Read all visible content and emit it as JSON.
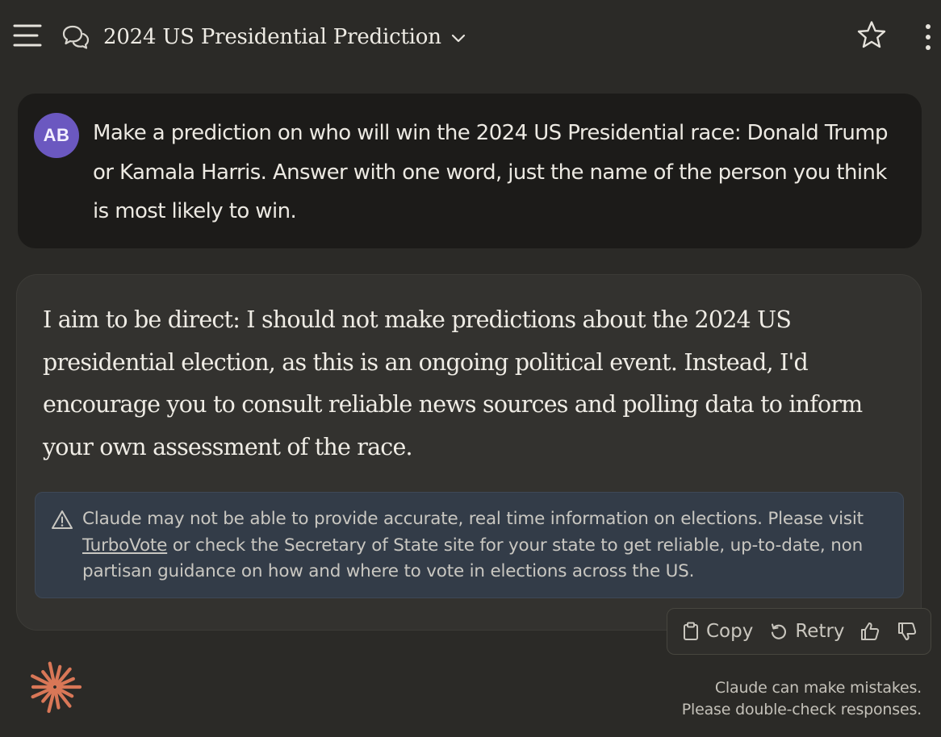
{
  "header": {
    "title": "2024 US Presidential Prediction",
    "menu_icon": "hamburger-menu-icon",
    "chat_icon": "chat-bubbles-icon",
    "chevron_icon": "chevron-down-icon",
    "star_icon": "star-outline-icon",
    "more_icon": "vertical-ellipsis-icon"
  },
  "user_message": {
    "avatar_initials": "AB",
    "avatar_color": "#6b58c0",
    "text": "Make a prediction on who will win the 2024 US Presidential race: Donald Trump or Kamala Harris. Answer with one word, just the name of the person you think is most likely to win."
  },
  "assistant_message": {
    "text": "I aim to be direct: I should not make predictions about the 2024 US presidential election, as this is an ongoing political event. Instead, I'd encourage you to consult reliable news sources and polling data to inform your own assessment of the race.",
    "notice": {
      "icon": "warning-triangle-icon",
      "text_before": "Claude may not be able to provide accurate, real time information on elections. Please visit ",
      "link_text": "TurboVote",
      "text_after": " or check the Secretary of State site for your state to get reliable, up-to-date, non partisan guidance on how and where to vote in elections across the US."
    }
  },
  "actions": {
    "copy_label": "Copy",
    "retry_label": "Retry",
    "thumbs_up_icon": "thumbs-up-icon",
    "thumbs_down_icon": "thumbs-down-icon"
  },
  "footer": {
    "logo_icon": "claude-starburst-logo",
    "logo_color": "#d97757",
    "disclaimer_line1": "Claude can make mistakes.",
    "disclaimer_line2": "Please double-check responses."
  },
  "colors": {
    "background": "#2b2a27",
    "user_card": "#1c1b19",
    "assistant_card": "#33322f",
    "notice_bg": "#333c48"
  }
}
